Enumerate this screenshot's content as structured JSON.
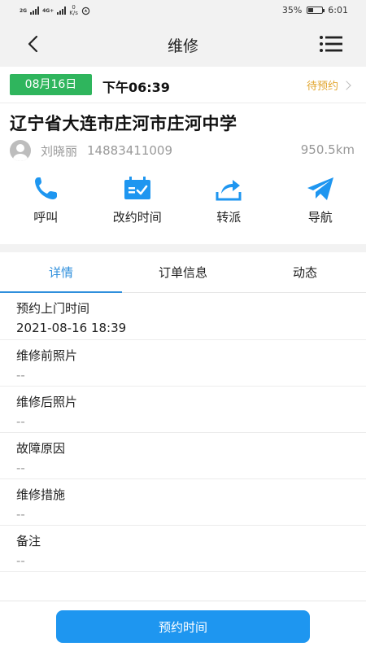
{
  "statusbar": {
    "sim1_tag": "2G",
    "sim2_tag": "4G+",
    "net_speed_value": "0",
    "net_speed_unit": "K/s",
    "battery_percent": "35%",
    "time": "6:01"
  },
  "nav": {
    "title": "维修",
    "back_icon": "chevron-left-icon",
    "menu_icon": "list-menu-icon"
  },
  "order": {
    "date": "08月16日",
    "time": "下午06:39",
    "status": "待预约",
    "address": "辽宁省大连市庄河市庄河中学",
    "contact_name": "刘晓丽",
    "contact_phone": "14883411009",
    "distance": "950.5km"
  },
  "actions": [
    {
      "label": "呼叫",
      "icon": "phone-icon"
    },
    {
      "label": "改约时间",
      "icon": "calendar-check-icon"
    },
    {
      "label": "转派",
      "icon": "share-forward-icon"
    },
    {
      "label": "导航",
      "icon": "paper-plane-icon"
    }
  ],
  "tabs": [
    {
      "label": "详情",
      "active": true
    },
    {
      "label": "订单信息",
      "active": false
    },
    {
      "label": "动态",
      "active": false
    }
  ],
  "details": [
    {
      "label": "预约上门时间",
      "value": "2021-08-16 18:39"
    },
    {
      "label": "维修前照片",
      "value": "--"
    },
    {
      "label": "维修后照片",
      "value": "--"
    },
    {
      "label": "故障原因",
      "value": "--"
    },
    {
      "label": "维修措施",
      "value": "--"
    },
    {
      "label": "备注",
      "value": "--"
    }
  ],
  "footer": {
    "button_label": "预约时间"
  },
  "colors": {
    "accent": "#1e96f0",
    "date_badge": "#2fb55d",
    "status": "#e2a52d",
    "tab_active": "#2f8fdc"
  }
}
